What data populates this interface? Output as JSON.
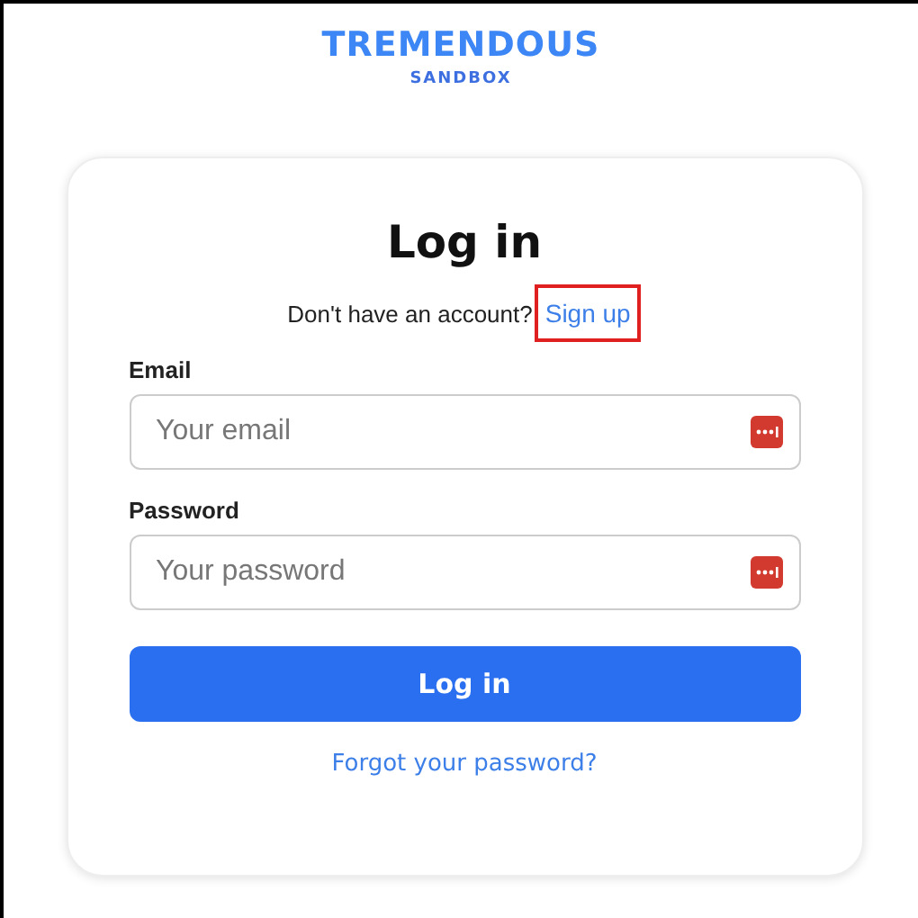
{
  "brand": {
    "name": "TREMENDOUS",
    "environment": "SANDBOX"
  },
  "form": {
    "title": "Log in",
    "signup_prompt": "Don't have an account?",
    "signup_link": {
      "label": "Sign up",
      "highlighted": true
    },
    "fields": [
      {
        "label": "Email",
        "placeholder": "Your email"
      },
      {
        "label": "Password",
        "placeholder": "Your password"
      }
    ],
    "submit": "Log in",
    "forgot_link": "Forgot your password?"
  }
}
